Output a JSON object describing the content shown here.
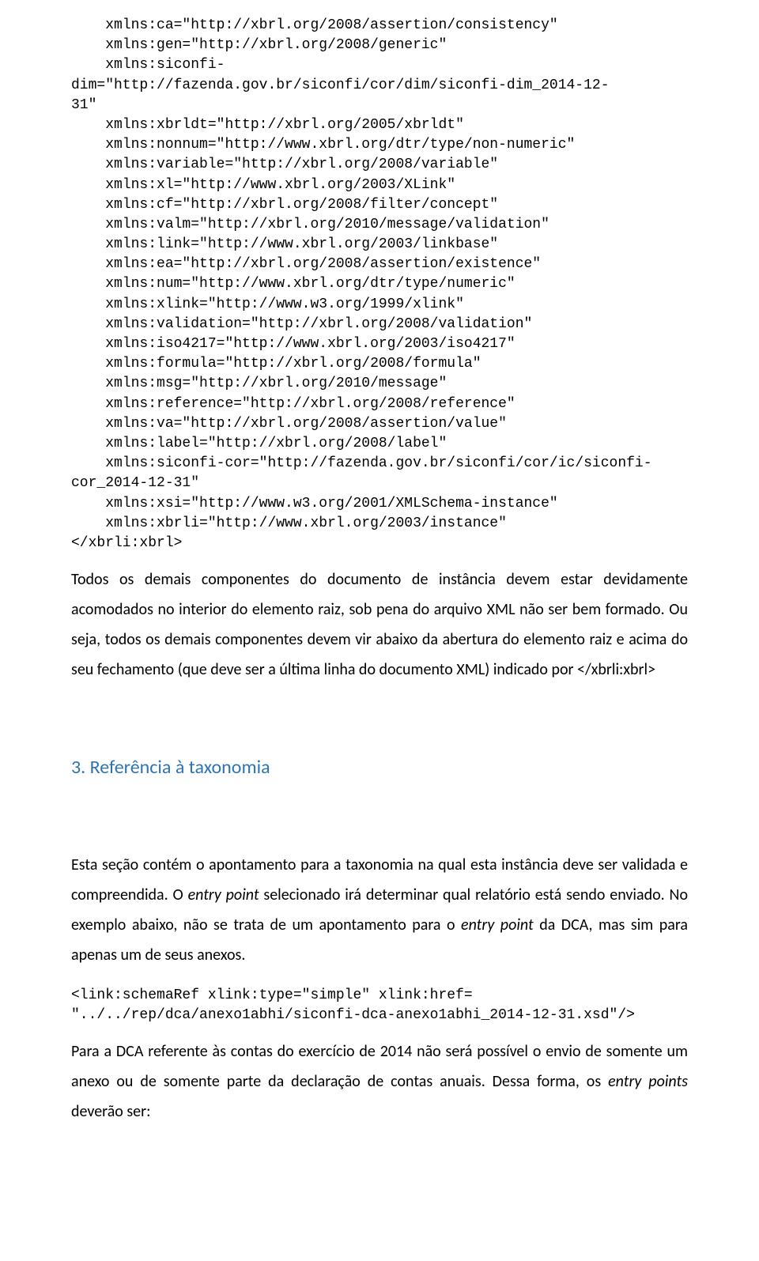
{
  "code_block_1": "    xmlns:ca=\"http://xbrl.org/2008/assertion/consistency\"\n    xmlns:gen=\"http://xbrl.org/2008/generic\"\n    xmlns:siconfi-\ndim=\"http://fazenda.gov.br/siconfi/cor/dim/siconfi-dim_2014-12-\n31\"\n    xmlns:xbrldt=\"http://xbrl.org/2005/xbrldt\"\n    xmlns:nonnum=\"http://www.xbrl.org/dtr/type/non-numeric\"\n    xmlns:variable=\"http://xbrl.org/2008/variable\"\n    xmlns:xl=\"http://www.xbrl.org/2003/XLink\"\n    xmlns:cf=\"http://xbrl.org/2008/filter/concept\"\n    xmlns:valm=\"http://xbrl.org/2010/message/validation\"\n    xmlns:link=\"http://www.xbrl.org/2003/linkbase\"\n    xmlns:ea=\"http://xbrl.org/2008/assertion/existence\"\n    xmlns:num=\"http://www.xbrl.org/dtr/type/numeric\"\n    xmlns:xlink=\"http://www.w3.org/1999/xlink\"\n    xmlns:validation=\"http://xbrl.org/2008/validation\"\n    xmlns:iso4217=\"http://www.xbrl.org/2003/iso4217\"\n    xmlns:formula=\"http://xbrl.org/2008/formula\"\n    xmlns:msg=\"http://xbrl.org/2010/message\"\n    xmlns:reference=\"http://xbrl.org/2008/reference\"\n    xmlns:va=\"http://xbrl.org/2008/assertion/value\"\n    xmlns:label=\"http://xbrl.org/2008/label\"\n    xmlns:siconfi-cor=\"http://fazenda.gov.br/siconfi/cor/ic/siconfi-\ncor_2014-12-31\"\n    xmlns:xsi=\"http://www.w3.org/2001/XMLSchema-instance\"\n    xmlns:xbrli=\"http://www.xbrl.org/2003/instance\"\n</xbrli:xbrl>",
  "para1": "Todos os demais componentes do documento de instância devem estar devidamente acomodados no interior do elemento raiz, sob pena do arquivo XML não ser bem formado. Ou seja, todos os demais componentes devem vir abaixo da abertura do elemento raiz e acima do seu fechamento (que deve ser a última linha do documento XML) indicado por </xbrli:xbrl>",
  "heading": "3.  Referência à taxonomia",
  "para3_pre": "Esta seção contém o apontamento para a taxonomia na qual esta instância deve ser validada e compreendida. O ",
  "para3_em1": "entry point",
  "para3_mid": " selecionado irá determinar qual relatório está sendo enviado. No exemplo abaixo, não se trata de um apontamento para o ",
  "para3_em2": "entry point",
  "para3_post": " da DCA, mas sim para apenas um de seus anexos.",
  "code_block_2": "<link:schemaRef xlink:type=\"simple\" xlink:href=\n\"../../rep/dca/anexo1abhi/siconfi-dca-anexo1abhi_2014-12-31.xsd\"/>",
  "para4_pre": "Para a DCA referente às contas do exercício de 2014 não será possível o envio de somente um anexo ou de somente parte da declaração de contas anuais. Dessa forma, os ",
  "para4_em": "entry points",
  "para4_post": " deverão ser:"
}
